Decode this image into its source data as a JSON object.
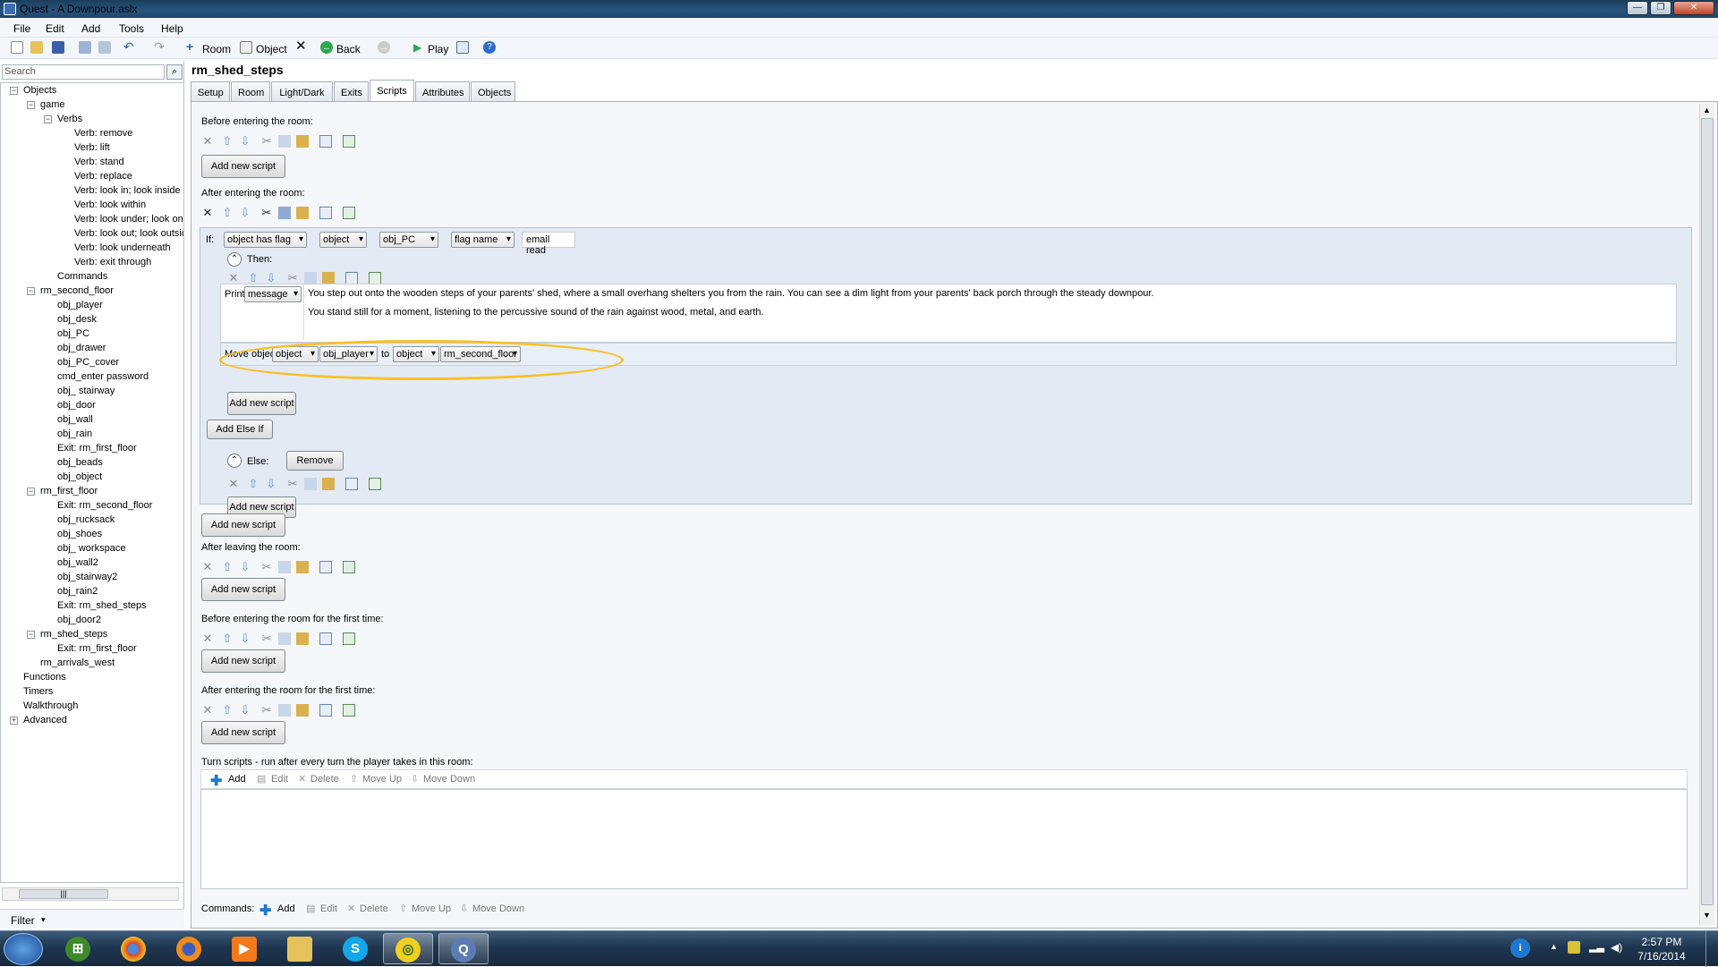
{
  "window": {
    "title": "Quest - A Downpour.aslx"
  },
  "menu": [
    "File",
    "Edit",
    "Add",
    "Tools",
    "Help"
  ],
  "toolbar": {
    "room": "Room",
    "object": "Object",
    "back": "Back",
    "play": "Play"
  },
  "search": {
    "placeholder": "Search"
  },
  "tree": {
    "objects": "Objects",
    "game": "game",
    "verbs": "Verbs",
    "verb_items": [
      "Verb: remove",
      "Verb: lift",
      "Verb: stand",
      "Verb: replace",
      "Verb: look in; look inside",
      "Verb: look within",
      "Verb: look under; look on",
      "Verb: look out; look outsic",
      "Verb: look underneath",
      "Verb: exit through"
    ],
    "commands": "Commands",
    "rm_second_floor": "rm_second_floor",
    "second_floor_items": [
      "obj_player",
      "obj_desk",
      "obj_PC",
      "obj_drawer",
      "obj_PC_cover",
      "cmd_enter password",
      "obj_ stairway",
      "obj_door",
      "obj_wall",
      "obj_rain",
      "Exit: rm_first_floor",
      "obj_beads",
      "obj_object"
    ],
    "rm_first_floor": "rm_first_floor",
    "first_floor_items": [
      "Exit: rm_second_floor",
      "obj_rucksack",
      "obj_shoes",
      "obj_ workspace",
      "obj_wall2",
      "obj_stairway2",
      "obj_rain2",
      "Exit: rm_shed_steps",
      "obj_door2"
    ],
    "rm_shed_steps": "rm_shed_steps",
    "shed_items": [
      "Exit: rm_first_floor"
    ],
    "rm_arrivals_west": "rm_arrivals_west",
    "functions": "Functions",
    "timers": "Timers",
    "walkthrough": "Walkthrough",
    "advanced": "Advanced"
  },
  "filter": {
    "label": "Filter"
  },
  "page": {
    "title": "rm_shed_steps"
  },
  "tabs": [
    "Setup",
    "Room",
    "Light/Dark",
    "Exits",
    "Scripts",
    "Attributes",
    "Objects"
  ],
  "scripts": {
    "before_entering": "Before entering the room:",
    "after_entering": "After entering the room:",
    "after_leaving": "After leaving the room:",
    "before_first": "Before entering the room for the first time:",
    "after_first": "After entering the room for the first time:",
    "turn_scripts": "Turn scripts - run after every turn the player takes in this room:",
    "commands": "Commands:",
    "add_new_script": "Add new script"
  },
  "if_block": {
    "if_label": "If:",
    "cond": [
      "object has flag",
      "object",
      "obj_PC",
      "flag name"
    ],
    "flag_value": "email read",
    "then_label": "Then:",
    "print_label": "Print",
    "print_type": "message",
    "message_line1": "You step out onto the wooden steps of your parents' shed, where a small overhang shelters you from the rain. You can see a dim light from your parents' back porch through the steady downpour.",
    "message_line2": "You stand still for a moment, listening to the percussive sound of the rain against wood, metal, and earth.",
    "move_label": "Move object",
    "move_type": "object",
    "move_obj": "obj_player",
    "to_label": "to",
    "to_type": "object",
    "to_obj": "rm_second_floor",
    "add_else_if": "Add Else If",
    "else_label": "Else:",
    "remove": "Remove"
  },
  "list_toolbar": {
    "add": "Add",
    "edit": "Edit",
    "delete": "Delete",
    "move_up": "Move Up",
    "move_down": "Move Down"
  },
  "clock": {
    "time": "2:57 PM",
    "date": "7/16/2014"
  },
  "colors": {
    "highlight_oval": "#f6c026",
    "if_block_bg": "#e3eaf4",
    "title_bar": "#28557e"
  }
}
